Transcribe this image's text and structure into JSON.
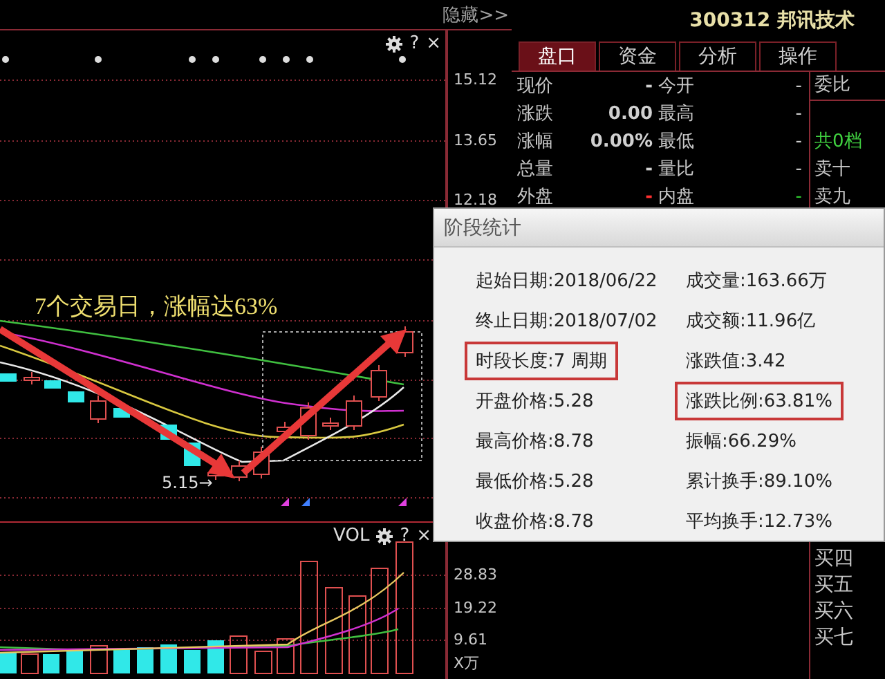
{
  "top_bar": {
    "hide_link": "隐藏>>"
  },
  "price_chart": {
    "toolbar": {
      "help": "?",
      "close": "×"
    },
    "annotation": "7个交易日，涨幅达63%",
    "low_label": "5.15→",
    "axis_labels": [
      "15.12",
      "13.65",
      "12.18"
    ]
  },
  "volume_chart": {
    "title": "VOL",
    "toolbar": {
      "help": "?",
      "close": "×"
    },
    "axis_labels": [
      "28.83",
      "19.22",
      "9.61"
    ],
    "unit": "X万"
  },
  "stock": {
    "title": "300312 邦讯技术"
  },
  "tabs": [
    {
      "label": "盘口",
      "selected": true
    },
    {
      "label": "资金",
      "selected": false
    },
    {
      "label": "分析",
      "selected": false
    },
    {
      "label": "操作",
      "selected": false
    }
  ],
  "quote_rows": [
    {
      "label": "现价",
      "value": {
        "text": "-",
        "color": "#d0d0d0"
      },
      "label2": "今开",
      "value2": {
        "text": "-",
        "color": "#d0d0d0"
      }
    },
    {
      "label": "涨跌",
      "value": {
        "text": "0.00",
        "color": "#d0d0d0"
      },
      "label2": "最高",
      "value2": {
        "text": "-",
        "color": "#d0d0d0"
      }
    },
    {
      "label": "涨幅",
      "value": {
        "text": "0.00%",
        "color": "#d0d0d0"
      },
      "label2": "最低",
      "value2": {
        "text": "-",
        "color": "#d0d0d0"
      }
    },
    {
      "label": "总量",
      "value": {
        "text": "-",
        "color": "#d0d0d0"
      },
      "label2": "量比",
      "value2": {
        "text": "-",
        "color": "#d0d0d0"
      }
    },
    {
      "label": "外盘",
      "value": {
        "text": "-",
        "color": "#ff3030"
      },
      "label2": "内盘",
      "value2": {
        "text": "-",
        "color": "#30d030"
      }
    }
  ],
  "order_book": {
    "ratio_label": "委比",
    "summary": "共0档",
    "ask_levels": [
      "卖十",
      "卖九"
    ],
    "bid_levels": [
      "买四",
      "买五",
      "买六",
      "买七"
    ]
  },
  "stats_dialog": {
    "title": "阶段统计",
    "items": [
      {
        "text": "起始日期:2018/06/22",
        "highlighted": false
      },
      {
        "text": "成交量:163.66万",
        "highlighted": false
      },
      {
        "text": "终止日期:2018/07/02",
        "highlighted": false
      },
      {
        "text": "成交额:11.96亿",
        "highlighted": false
      },
      {
        "text": "时段长度:7 周期",
        "highlighted": true
      },
      {
        "text": "涨跌值:3.42",
        "highlighted": false
      },
      {
        "text": "开盘价格:5.28",
        "highlighted": false
      },
      {
        "text": "涨跌比例:63.81%",
        "highlighted": true
      },
      {
        "text": "最高价格:8.78",
        "highlighted": false
      },
      {
        "text": "振幅:66.29%",
        "highlighted": false
      },
      {
        "text": "最低价格:5.28",
        "highlighted": false
      },
      {
        "text": "累计换手:89.10%",
        "highlighted": false
      },
      {
        "text": "收盘价格:8.78",
        "highlighted": false
      },
      {
        "text": "平均换手:12.73%",
        "highlighted": false
      }
    ]
  }
}
